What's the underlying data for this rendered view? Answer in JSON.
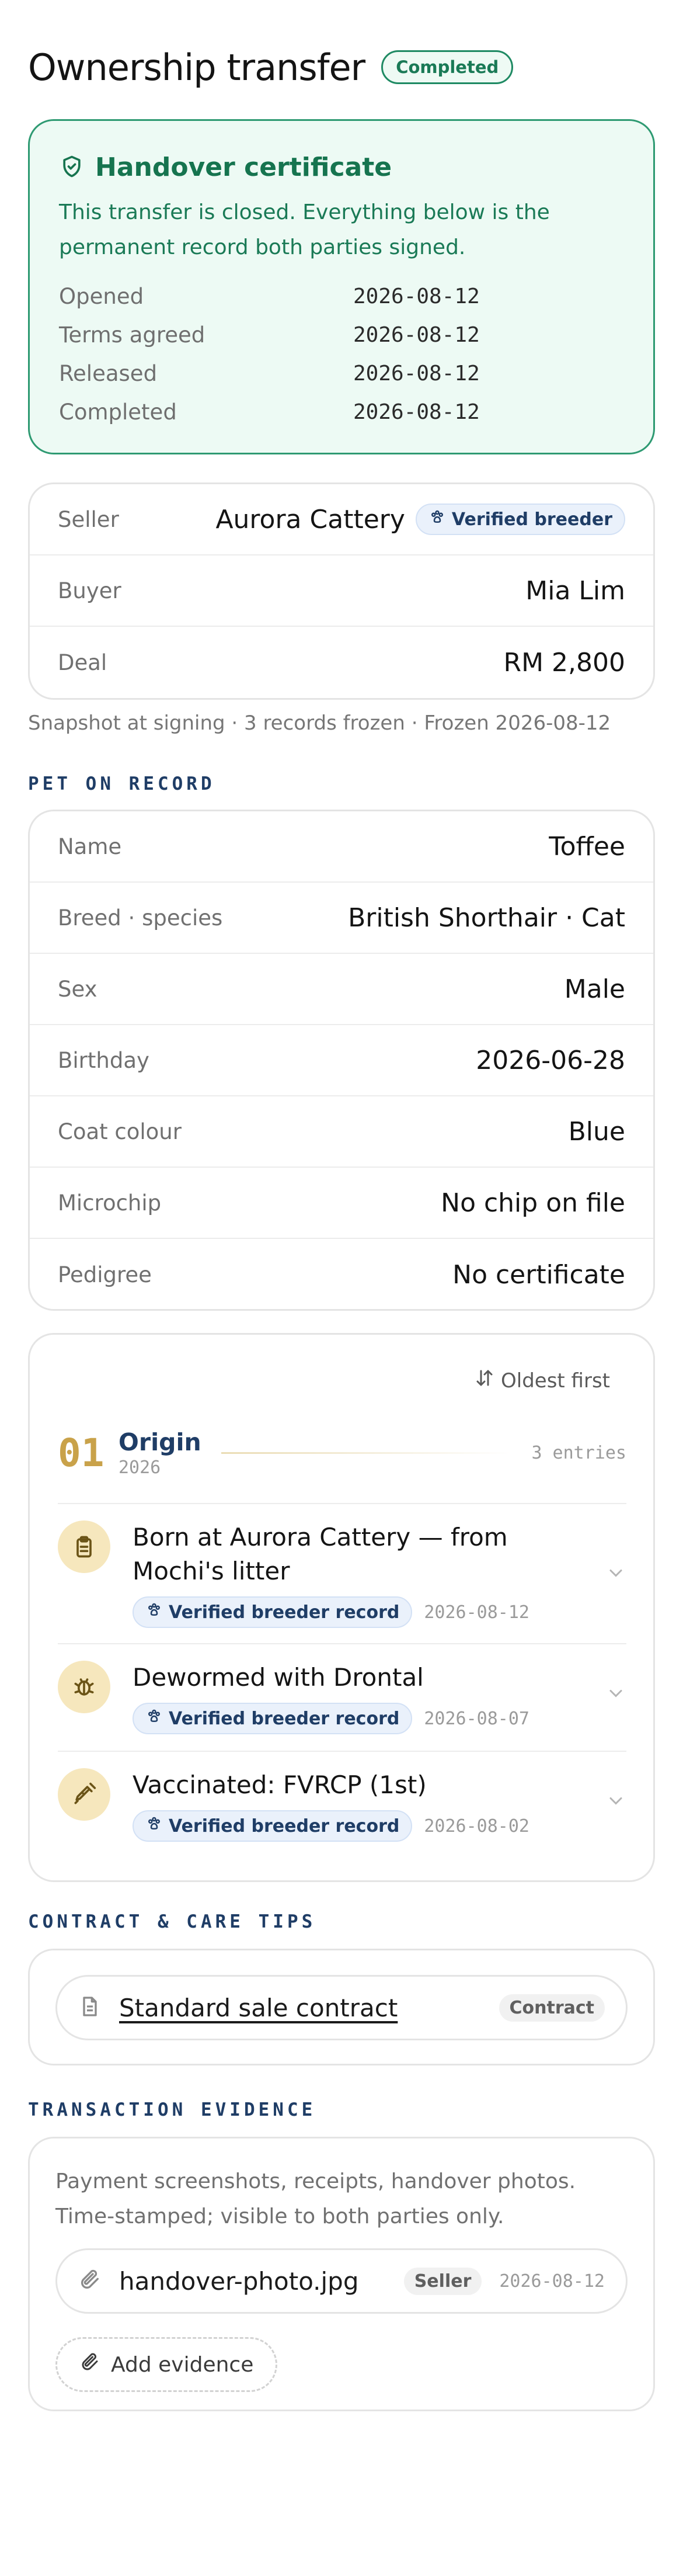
{
  "header": {
    "title": "Ownership transfer",
    "status": "Completed"
  },
  "certificate": {
    "title": "Handover certificate",
    "description": "This transfer is closed. Everything below is the permanent record both parties signed.",
    "rows": [
      {
        "label": "Opened",
        "value": "2026-08-12"
      },
      {
        "label": "Terms agreed",
        "value": "2026-08-12"
      },
      {
        "label": "Released",
        "value": "2026-08-12"
      },
      {
        "label": "Completed",
        "value": "2026-08-12"
      }
    ]
  },
  "parties": {
    "seller_label": "Seller",
    "seller_value": "Aurora Cattery",
    "seller_badge": "Verified breeder",
    "buyer_label": "Buyer",
    "buyer_value": "Mia Lim",
    "deal_label": "Deal",
    "deal_value": "RM 2,800"
  },
  "snapshot_text": "Snapshot at signing · 3 records frozen · Frozen 2026-08-12",
  "pet_section_label": "PET ON RECORD",
  "pet": [
    {
      "label": "Name",
      "value": "Toffee"
    },
    {
      "label": "Breed · species",
      "value": "British Shorthair · Cat"
    },
    {
      "label": "Sex",
      "value": "Male"
    },
    {
      "label": "Birthday",
      "value": "2026-06-28"
    },
    {
      "label": "Coat colour",
      "value": "Blue"
    },
    {
      "label": "Microchip",
      "value": "No chip on file"
    },
    {
      "label": "Pedigree",
      "value": "No certificate"
    }
  ],
  "timeline": {
    "sort_label": "Oldest first",
    "group": {
      "number": "01",
      "name": "Origin",
      "year": "2026",
      "count": "3 entries"
    },
    "items": [
      {
        "title": "Born at Aurora Cattery — from Mochi's litter",
        "badge": "Verified breeder record",
        "date": "2026-08-12",
        "icon": "clipboard-icon"
      },
      {
        "title": "Dewormed with Drontal",
        "badge": "Verified breeder record",
        "date": "2026-08-07",
        "icon": "bug-icon"
      },
      {
        "title": "Vaccinated: FVRCP (1st)",
        "badge": "Verified breeder record",
        "date": "2026-08-02",
        "icon": "syringe-icon"
      }
    ]
  },
  "contract_section_label": "CONTRACT & CARE TIPS",
  "contract": {
    "link": "Standard sale contract",
    "tag": "Contract"
  },
  "evidence_section_label": "TRANSACTION EVIDENCE",
  "evidence": {
    "description": "Payment screenshots, receipts, handover photos. Time-stamped; visible to both parties only.",
    "file_name": "handover-photo.jpg",
    "file_tag": "Seller",
    "file_date": "2026-08-12",
    "add_label": "Add evidence"
  },
  "colors": {
    "accent_green": "#1f8a63",
    "navy": "#1f3d66",
    "gold": "#c9a24a"
  }
}
